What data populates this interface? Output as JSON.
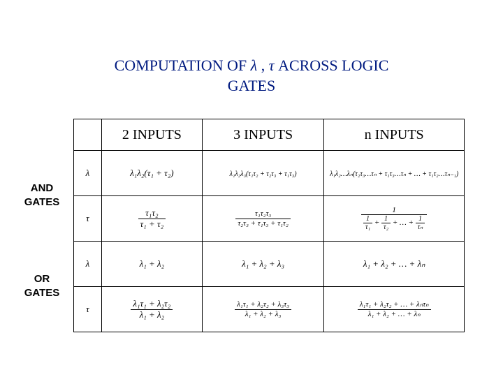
{
  "title": {
    "prefix": "COMPUTATION  OF ",
    "sym1": "λ",
    "comma": " , ",
    "sym2": "τ",
    "mid": "  ACROSS    LOGIC",
    "line2": "GATES"
  },
  "headers": {
    "h2": "2 INPUTS",
    "h3": "3 INPUTS",
    "hn": "n  INPUTS"
  },
  "rowlabels": {
    "and1": "AND",
    "and2": "GATES",
    "or1": "OR",
    "or2": "GATES"
  },
  "symbols": {
    "lambda": "λ",
    "tau": "τ"
  },
  "cells": {
    "and_lambda_2": "λ₁λ₂(τ₁ + τ₂)",
    "and_lambda_3": "λ₁λ₂λ₃(τ₁τ₂ + τ₂τ₃ + τ₁τ₃)",
    "and_lambda_n": "λ₁λ₂…λₙ(τ₂τ₃…τₙ + τ₁τ₃…τₙ + … + τ₁τ₂…τₙ₋₁)",
    "and_tau_2_num": "τ₁τ₂",
    "and_tau_2_den": "τ₁ + τ₂",
    "and_tau_3_num": "τ₁τ₂τ₃",
    "and_tau_3_den": "τ₂τ₃ + τ₁τ₃ + τ₁τ₂",
    "and_tau_n_num": "1",
    "and_tau_n_den_a": "1",
    "and_tau_n_den_b": "τ₁",
    "and_tau_n_den_c": "1",
    "and_tau_n_den_d": "τ₂",
    "and_tau_n_den_e": "1",
    "and_tau_n_den_f": "τₙ",
    "plus": " + ",
    "ldots": " + … + ",
    "or_lambda_2": "λ₁ + λ₂",
    "or_lambda_3": "λ₁ + λ₂ + λ₃",
    "or_lambda_n": "λ₁ + λ₂ + … + λₙ",
    "or_tau_2_num": "λ₁τ₁ + λ₂τ₂",
    "or_tau_2_den": "λ₁ + λ₂",
    "or_tau_3_num": "λ₁τ₁ + λ₂τ₂ + λ₃τ₃",
    "or_tau_3_den": "λ₁ + λ₂ + λ₃",
    "or_tau_n_num": "λ₁τ₁ + λ₂τ₂ + … + λₙτₙ",
    "or_tau_n_den": "λ₁ + λ₂ + … + λₙ"
  }
}
